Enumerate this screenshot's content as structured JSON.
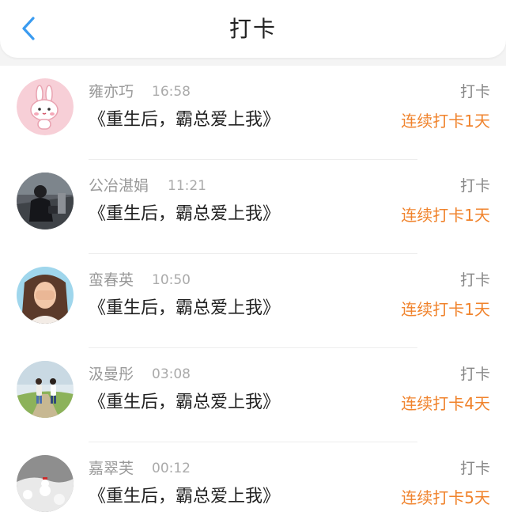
{
  "header": {
    "title": "打卡",
    "back_icon": "chevron-left-icon",
    "accent": "#3a9bf0"
  },
  "items": [
    {
      "name": "雍亦巧",
      "time": "16:58",
      "book": "《重生后，霸总爱上我》",
      "action": "打卡",
      "streak": "连续打卡1天",
      "avatar": "rabbit-avatar"
    },
    {
      "name": "公冶湛娟",
      "time": "11:21",
      "book": "《重生后，霸总爱上我》",
      "action": "打卡",
      "streak": "连续打卡1天",
      "avatar": "girl-photo-avatar"
    },
    {
      "name": "蛮春英",
      "time": "10:50",
      "book": "《重生后，霸总爱上我》",
      "action": "打卡",
      "streak": "连续打卡1天",
      "avatar": "girl-covering-face-avatar"
    },
    {
      "name": "汲曼彤",
      "time": "03:08",
      "book": "《重生后，霸总爱上我》",
      "action": "打卡",
      "streak": "连续打卡4天",
      "avatar": "couple-walking-avatar"
    },
    {
      "name": "嘉翠芙",
      "time": "00:12",
      "book": "《重生后，霸总爱上我》",
      "action": "打卡",
      "streak": "连续打卡5天",
      "avatar": "snow-scene-avatar"
    }
  ],
  "colors": {
    "streak": "#f0832c",
    "name": "#999999",
    "text": "#222222"
  }
}
